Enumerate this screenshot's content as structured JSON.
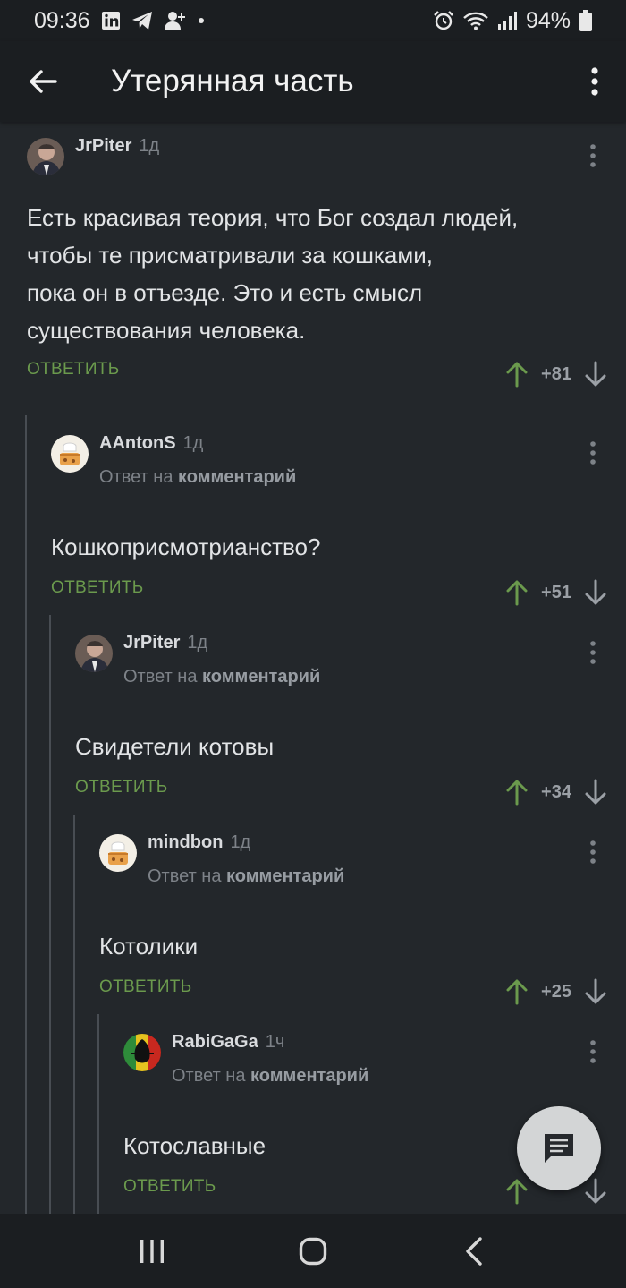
{
  "status_bar": {
    "time": "09:36",
    "battery": "94%",
    "icons": [
      "linkedin-icon",
      "telegram-icon",
      "add-user-icon",
      "dot-icon",
      "alarm-icon",
      "wifi-icon",
      "signal-icon",
      "battery-icon"
    ]
  },
  "app_bar": {
    "title": "Утерянная часть"
  },
  "comments": [
    {
      "author": "JrPiter",
      "time": "1д",
      "reply_prefix": "",
      "reply_target": "",
      "text_lines": [
        "Есть красивая теория, что Бог создал людей,",
        "чтобы те присматривали за кошками,",
        "пока он в отъезде. Это и есть смысл",
        "существования человека."
      ],
      "reply_label": "ОТВЕТИТЬ",
      "score": "+81"
    },
    {
      "author": "AAntonS",
      "time": "1д",
      "reply_prefix": "Ответ на",
      "reply_target": "комментарий",
      "text_lines": [
        "Кошкоприсмотрианство?"
      ],
      "reply_label": "ОТВЕТИТЬ",
      "score": "+51"
    },
    {
      "author": "JrPiter",
      "time": "1д",
      "reply_prefix": "Ответ на",
      "reply_target": "комментарий",
      "text_lines": [
        "Свидетели котовы"
      ],
      "reply_label": "ОТВЕТИТЬ",
      "score": "+34"
    },
    {
      "author": "mindbon",
      "time": "1д",
      "reply_prefix": "Ответ на",
      "reply_target": "комментарий",
      "text_lines": [
        "Котолики"
      ],
      "reply_label": "ОТВЕТИТЬ",
      "score": "+25"
    },
    {
      "author": "RabiGaGa",
      "time": "1ч",
      "reply_prefix": "Ответ на",
      "reply_target": "комментарий",
      "text_lines": [
        "Котославные"
      ],
      "reply_label": "ОТВЕТИТЬ",
      "score": ""
    }
  ],
  "colors": {
    "background": "#23272b",
    "bars": "#1b1e21",
    "reply_green": "#6b9a4d",
    "upvote_green": "#6b9a4d",
    "muted": "#7d8288"
  },
  "nav_bar": {
    "buttons": [
      "recents-icon",
      "home-icon",
      "back-icon"
    ]
  }
}
